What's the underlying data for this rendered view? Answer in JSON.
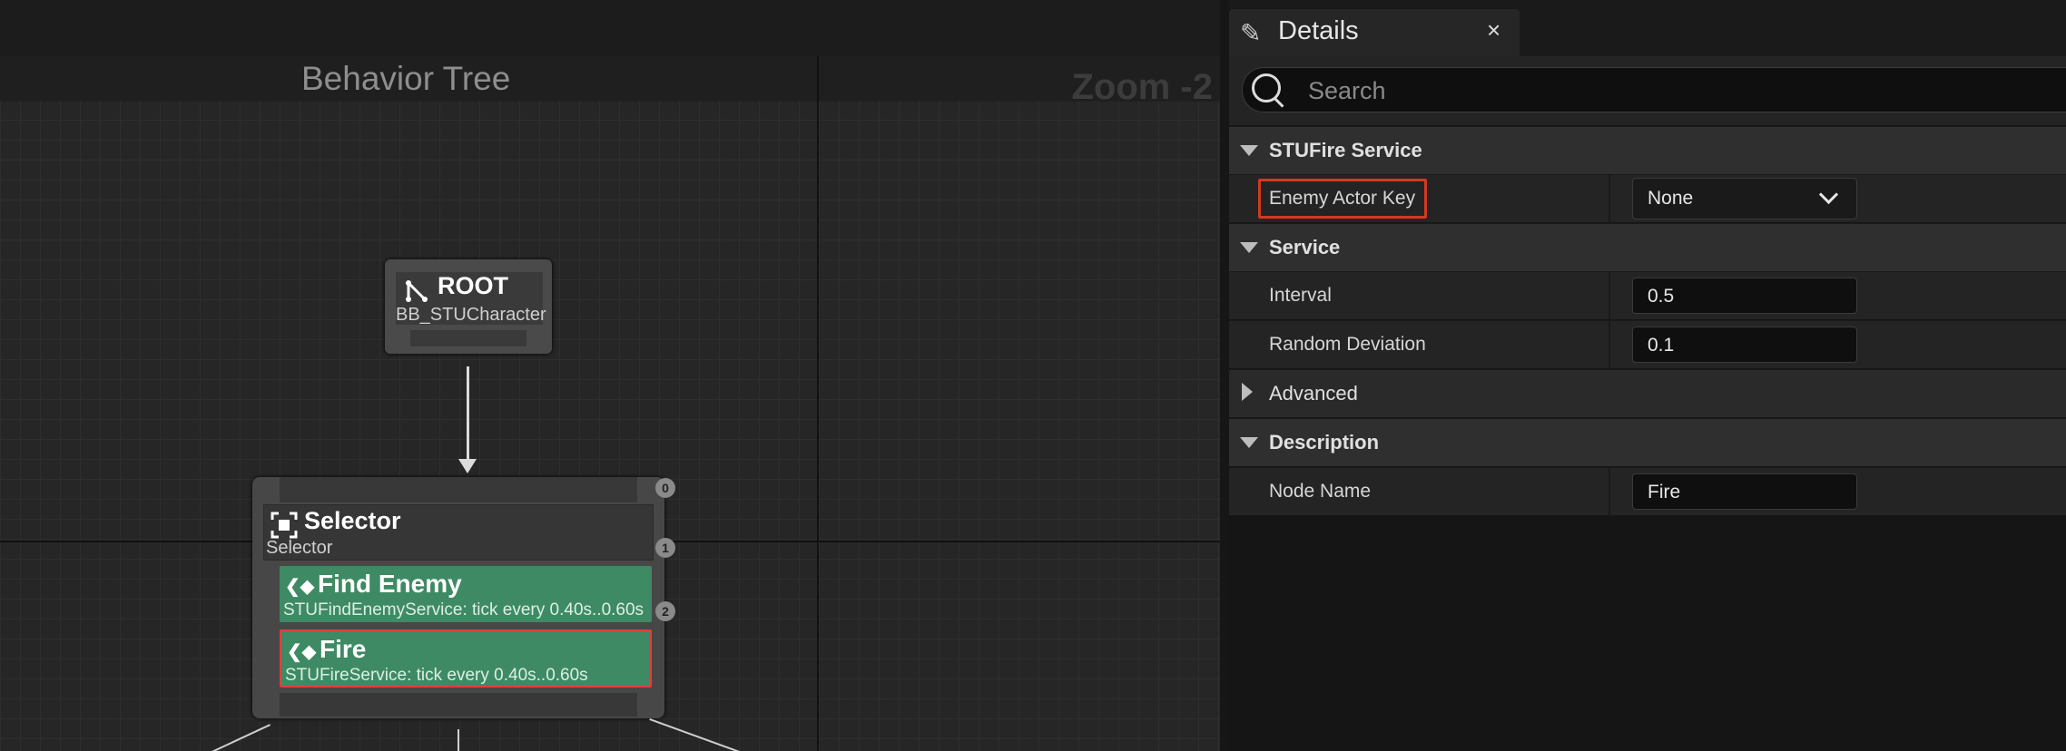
{
  "graph": {
    "title": "Behavior Tree",
    "zoom": "Zoom -2",
    "root": {
      "title": "ROOT",
      "subtitle": "BB_STUCharacter"
    },
    "selector": {
      "title": "Selector",
      "subtitle": "Selector",
      "pins": [
        "0",
        "1",
        "2"
      ],
      "services": [
        {
          "title": "Find Enemy",
          "subtitle": "STUFindEnemyService: tick every 0.40s..0.60s",
          "selected": false
        },
        {
          "title": "Fire",
          "subtitle": "STUFireService: tick every 0.40s..0.60s",
          "selected": true
        }
      ]
    },
    "colors": {
      "service": "#3e8a64",
      "selection": "#e0403a"
    }
  },
  "details": {
    "tab_label": "Details",
    "tab_close": "×",
    "search_placeholder": "Search",
    "sections": {
      "stufire": {
        "label": "STUFire Service"
      },
      "service": {
        "label": "Service"
      },
      "advanced": {
        "label": "Advanced"
      },
      "description": {
        "label": "Description"
      }
    },
    "rows": {
      "enemy_actor_key": {
        "label": "Enemy Actor Key",
        "value": "None"
      },
      "interval": {
        "label": "Interval",
        "value": "0.5"
      },
      "random_deviation": {
        "label": "Random Deviation",
        "value": "0.1"
      },
      "node_name": {
        "label": "Node Name",
        "value": "Fire"
      }
    }
  }
}
